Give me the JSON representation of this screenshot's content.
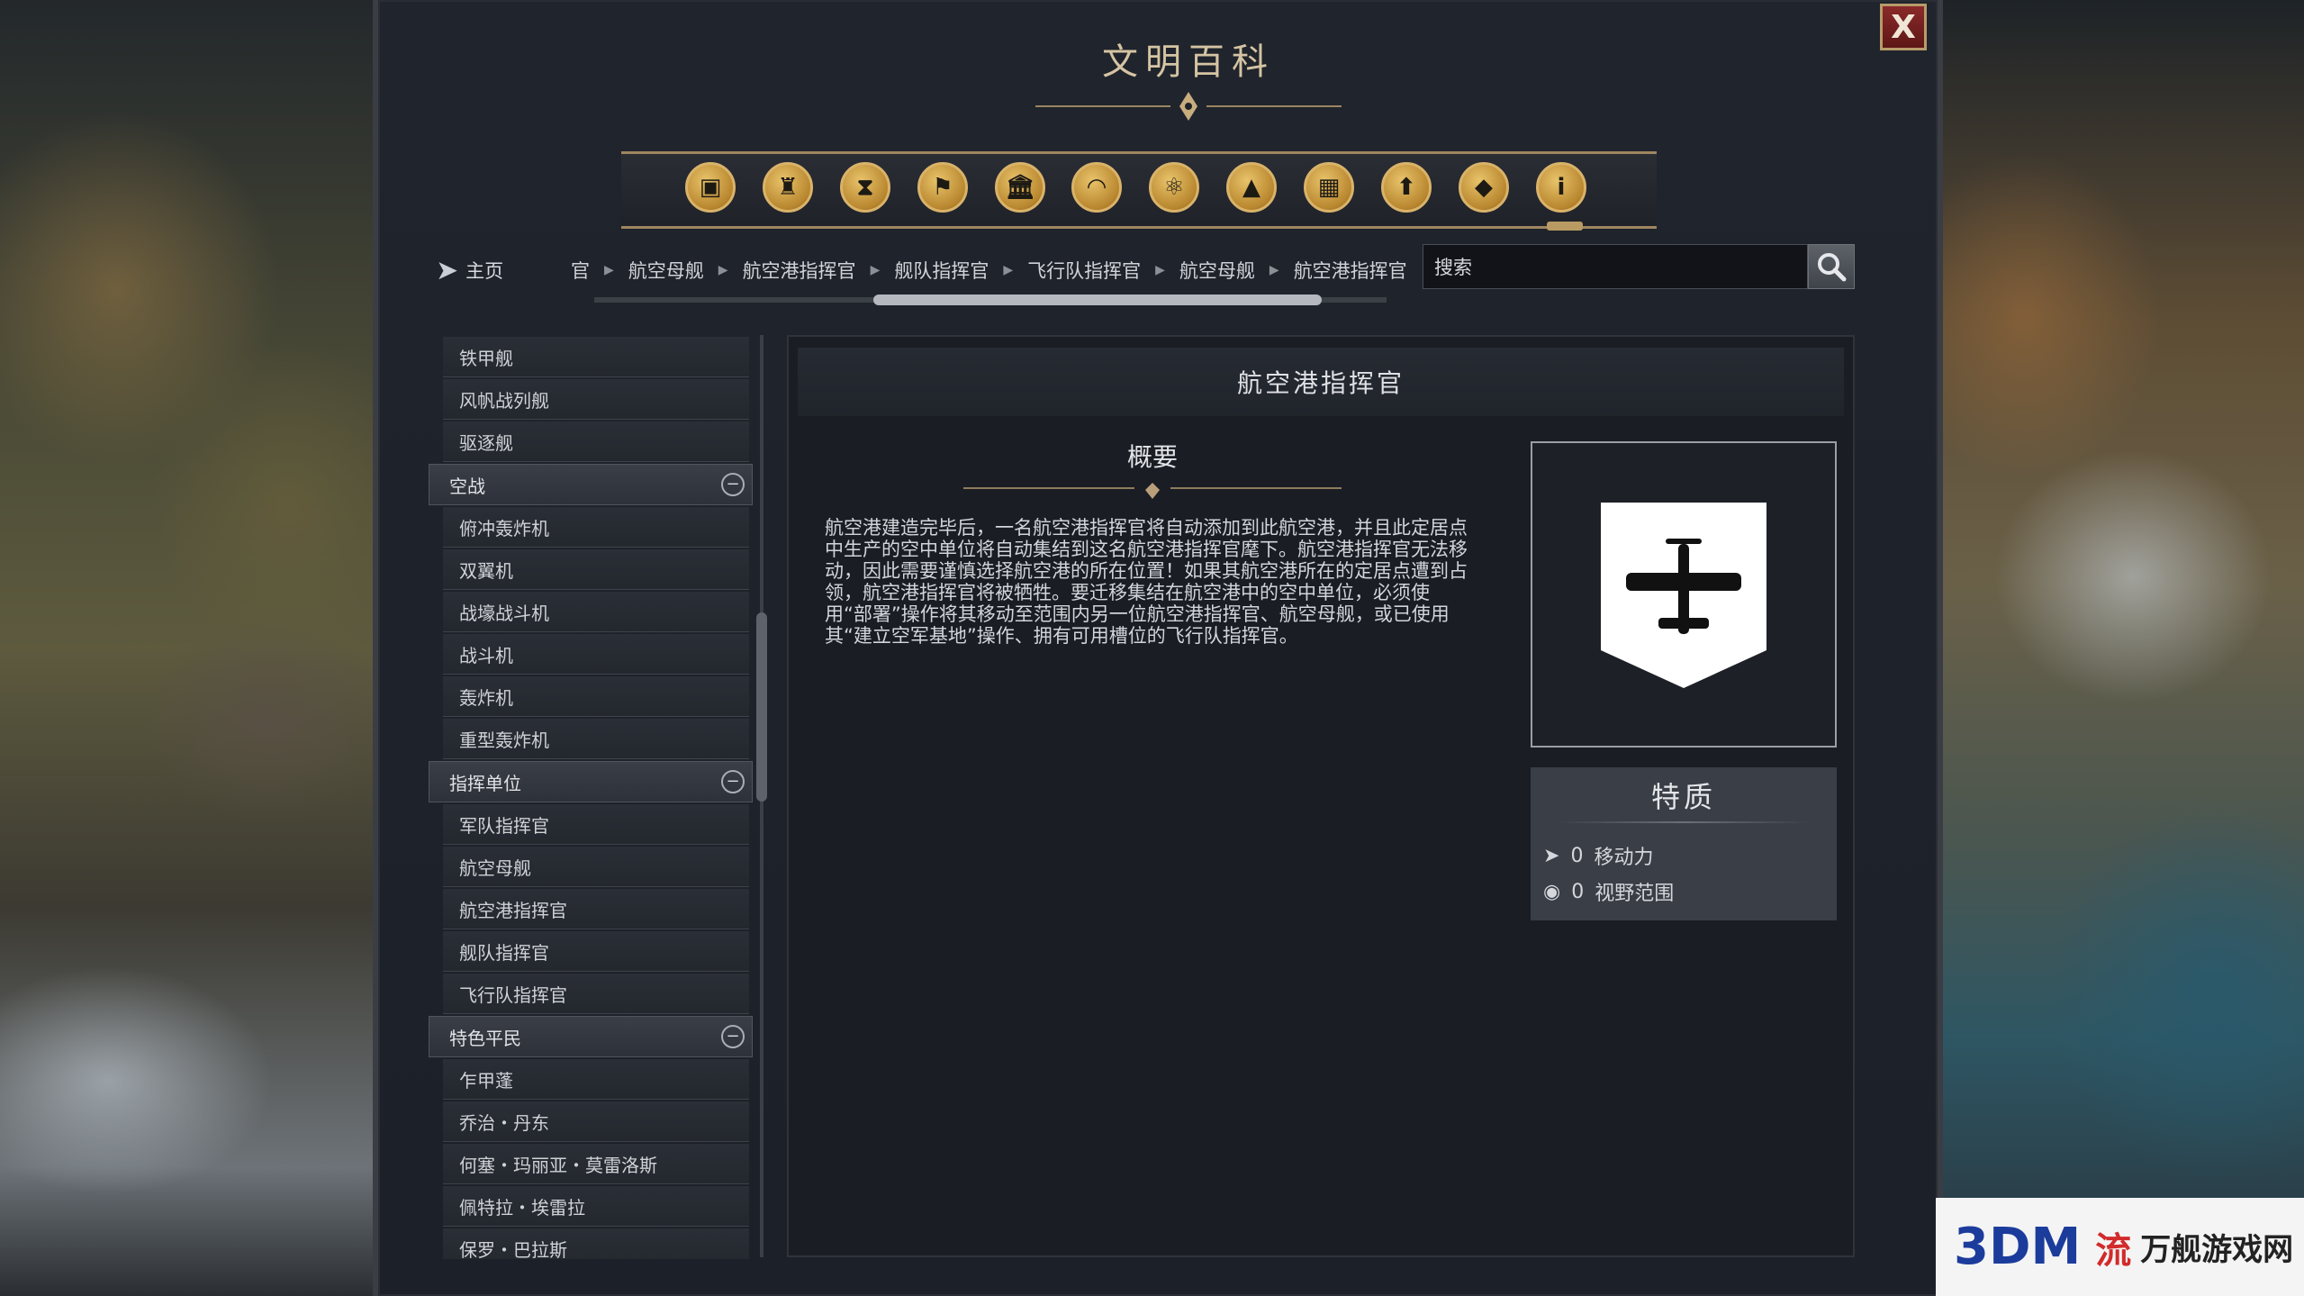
{
  "window": {
    "title": "文明百科",
    "close_label": "X"
  },
  "category_icons": [
    {
      "name": "units-icon",
      "glyph": "▣"
    },
    {
      "name": "policies-icon",
      "glyph": "♜"
    },
    {
      "name": "eras-icon",
      "glyph": "⧗"
    },
    {
      "name": "civilizations-icon",
      "glyph": "⚑"
    },
    {
      "name": "buildings-icon",
      "glyph": "🏛"
    },
    {
      "name": "wonders-icon",
      "glyph": "◠"
    },
    {
      "name": "science-icon",
      "glyph": "⚛"
    },
    {
      "name": "terrain-icon",
      "glyph": "▲"
    },
    {
      "name": "districts-icon",
      "glyph": "▦"
    },
    {
      "name": "promotions-icon",
      "glyph": "⬆"
    },
    {
      "name": "resources-icon",
      "glyph": "◆"
    },
    {
      "name": "info-icon",
      "glyph": "i"
    }
  ],
  "breadcrumb": {
    "home_label": "主页",
    "items": [
      "官",
      "航空母舰",
      "航空港指挥官",
      "舰队指挥官",
      "飞行队指挥官",
      "航空母舰",
      "航空港指挥官"
    ]
  },
  "search": {
    "placeholder": "搜索"
  },
  "sidebar": {
    "top_items": [
      "铁甲舰",
      "风帆战列舰",
      "驱逐舰"
    ],
    "categories": [
      {
        "label": "空战",
        "items": [
          "俯冲轰炸机",
          "双翼机",
          "战壕战斗机",
          "战斗机",
          "轰炸机",
          "重型轰炸机"
        ]
      },
      {
        "label": "指挥单位",
        "items": [
          "军队指挥官",
          "航空母舰",
          "航空港指挥官",
          "舰队指挥官",
          "飞行队指挥官"
        ]
      },
      {
        "label": "特色平民",
        "items": [
          "乍甲蓬",
          "乔治・丹东",
          "何塞・玛丽亚・莫雷洛斯",
          "佩特拉・埃雷拉",
          "保罗・巴拉斯"
        ]
      }
    ]
  },
  "content": {
    "header": "航空港指挥官",
    "summary_title": "概要",
    "summary_body": "航空港建造完毕后，一名航空港指挥官将自动添加到此航空港，并且此定居点中生产的空中单位将自动集结到这名航空港指挥官麾下。航空港指挥官无法移动，因此需要谨慎选择航空港的所在位置！如果其航空港所在的定居点遭到占领，航空港指挥官将被牺牲。要迁移集结在航空港中的空中单位，必须使用“部署”操作将其移动至范围内另一位航空港指挥官、航空母舰，或已使用其“建立空军基地”操作、拥有可用槽位的飞行队指挥官。",
    "portrait_icon": "airplane-icon",
    "traits_title": "特质",
    "traits": [
      {
        "icon": "movement-icon",
        "value": "0",
        "label": "移动力"
      },
      {
        "icon": "sight-icon",
        "value": "0",
        "label": "视野范围"
      }
    ]
  },
  "watermark": {
    "a": "3DM",
    "b": "流",
    "c": "万舰游戏网"
  },
  "colors": {
    "gold": "#d9b36a",
    "panel": "#20242c",
    "close_red": "#8a2a2a"
  }
}
